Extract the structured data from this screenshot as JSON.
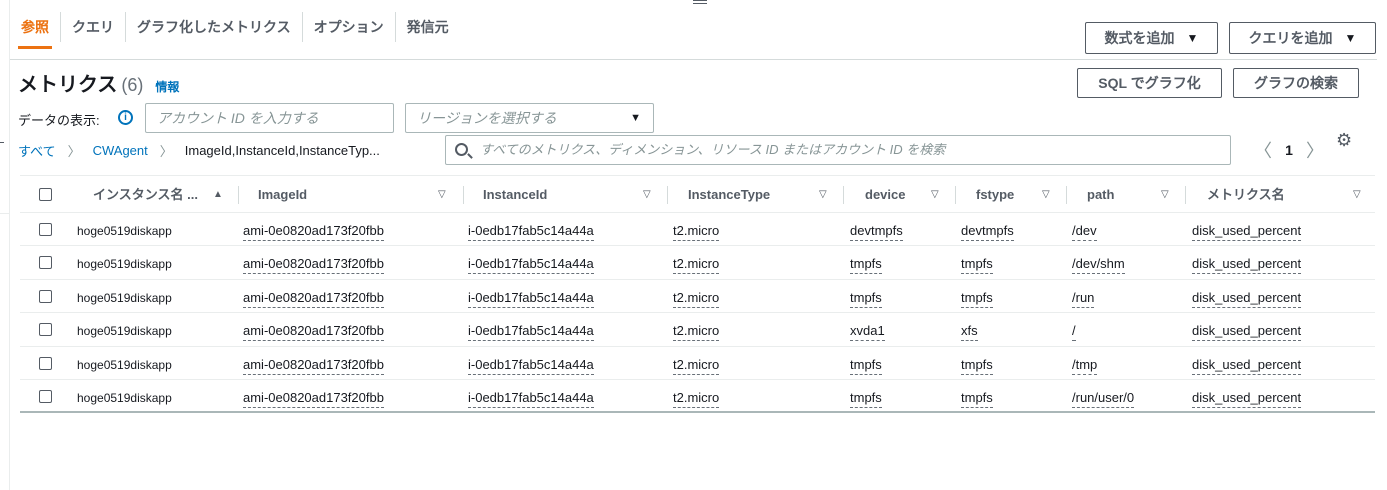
{
  "tabs": [
    {
      "label": "参照",
      "active": true
    },
    {
      "label": "クエリ",
      "active": false
    },
    {
      "label": "グラフ化したメトリクス",
      "active": false
    },
    {
      "label": "オプション",
      "active": false
    },
    {
      "label": "発信元",
      "active": false
    }
  ],
  "buttons": {
    "add_math": "数式を追加",
    "add_query": "クエリを追加",
    "graph_sql": "SQL でグラフ化",
    "graph_search": "グラフの検索"
  },
  "header": {
    "title": "メトリクス",
    "count": "(6)",
    "info": "情報"
  },
  "filters": {
    "data_label": "データの表示:",
    "account_placeholder": "アカウント ID を入力する",
    "region_placeholder": "リージョンを選択する"
  },
  "breadcrumb": {
    "all": "すべて",
    "namespace": "CWAgent",
    "dimensions": "ImageId,InstanceId,InstanceTyp..."
  },
  "search": {
    "placeholder": "すべてのメトリクス、ディメンション、リソース ID またはアカウント ID を検索"
  },
  "pagination": {
    "current_page": "1"
  },
  "table": {
    "columns": [
      "インスタンス名 ...",
      "ImageId",
      "InstanceId",
      "InstanceType",
      "device",
      "fstype",
      "path",
      "メトリクス名"
    ],
    "rows": [
      [
        "hoge0519diskapp",
        "ami-0e0820ad173f20fbb",
        "i-0edb17fab5c14a44a",
        "t2.micro",
        "devtmpfs",
        "devtmpfs",
        "/dev",
        "disk_used_percent"
      ],
      [
        "hoge0519diskapp",
        "ami-0e0820ad173f20fbb",
        "i-0edb17fab5c14a44a",
        "t2.micro",
        "tmpfs",
        "tmpfs",
        "/dev/shm",
        "disk_used_percent"
      ],
      [
        "hoge0519diskapp",
        "ami-0e0820ad173f20fbb",
        "i-0edb17fab5c14a44a",
        "t2.micro",
        "tmpfs",
        "tmpfs",
        "/run",
        "disk_used_percent"
      ],
      [
        "hoge0519diskapp",
        "ami-0e0820ad173f20fbb",
        "i-0edb17fab5c14a44a",
        "t2.micro",
        "xvda1",
        "xfs",
        "/",
        "disk_used_percent"
      ],
      [
        "hoge0519diskapp",
        "ami-0e0820ad173f20fbb",
        "i-0edb17fab5c14a44a",
        "t2.micro",
        "tmpfs",
        "tmpfs",
        "/tmp",
        "disk_used_percent"
      ],
      [
        "hoge0519diskapp",
        "ami-0e0820ad173f20fbb",
        "i-0edb17fab5c14a44a",
        "t2.micro",
        "tmpfs",
        "tmpfs",
        "/run/user/0",
        "disk_used_percent"
      ]
    ]
  },
  "colors": {
    "accent": "#ec7211",
    "link": "#0073bb"
  },
  "icons": [
    "drag-handle-icon",
    "info-icon",
    "search-icon",
    "chevron-left-icon",
    "chevron-right-icon",
    "gear-icon",
    "sort-ascending-icon",
    "sort-descending-icon",
    "caret-down-icon",
    "breadcrumb-chevron-icon"
  ]
}
